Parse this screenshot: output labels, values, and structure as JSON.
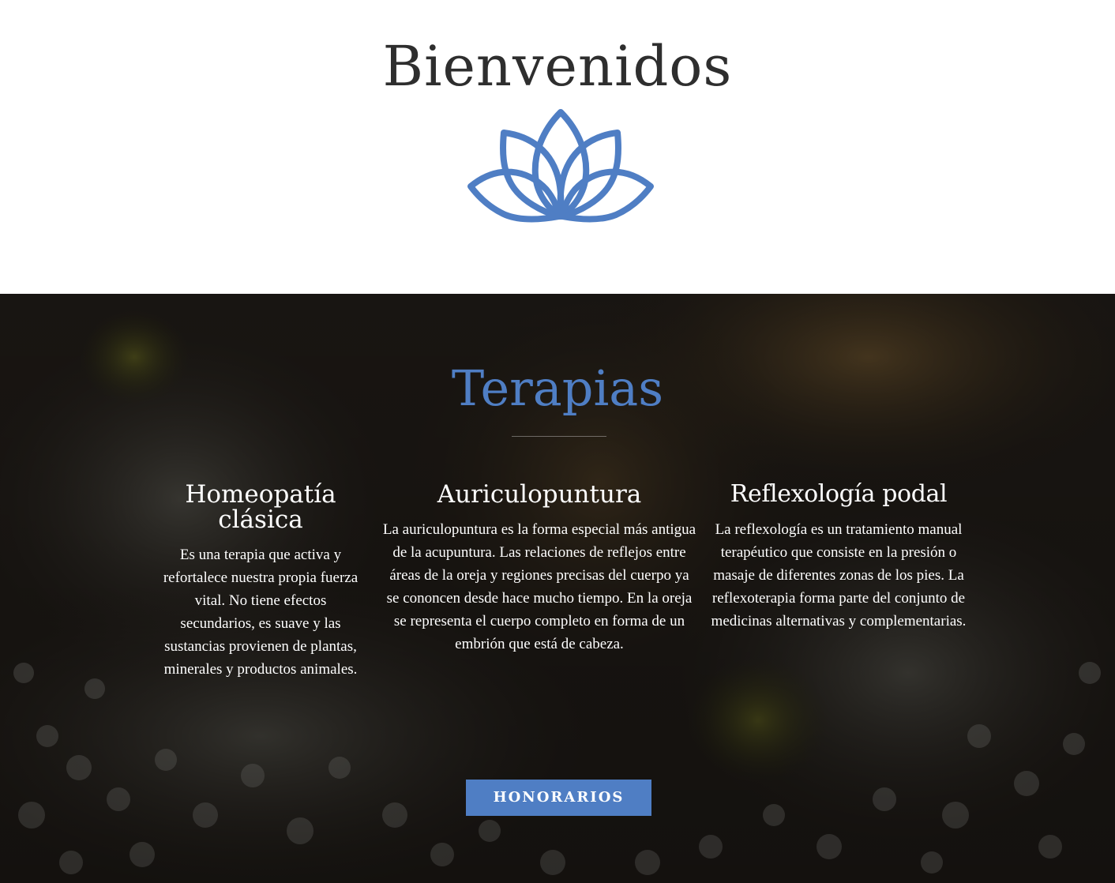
{
  "welcome": {
    "title": "Bienvenidos",
    "icon": "lotus-icon"
  },
  "therapies": {
    "title": "Terapias",
    "items": [
      {
        "title": "Homeopatía clásica",
        "text": "Es una terapia que activa y refortalece nuestra propia fuerza vital. No tiene efectos secundarios, es suave y las sustancias provienen de plantas, minerales y productos animales."
      },
      {
        "title": "Auriculopuntura",
        "text": "La auriculopuntura es la forma especial más antigua de la acupuntura. Las relaciones de reflejos entre áreas de la oreja y regiones precisas del cuerpo ya se cononcen desde hace mucho tiempo. En la oreja se representa el cuerpo completo en forma de un embrión que está de cabeza."
      },
      {
        "title": "Reflexología podal",
        "text": "La reflexología es un tratamiento manual terapéutico que consiste en la presión o masaje de diferentes zonas de los pies. La reflexoterapia forma parte del conjunto de medicinas alternativas y complementarias."
      }
    ],
    "button_label": "HONORARIOS"
  },
  "colors": {
    "accent": "#4f7ec4",
    "heading_dark": "#2e2e2e",
    "section_background": "#1f1b17"
  }
}
